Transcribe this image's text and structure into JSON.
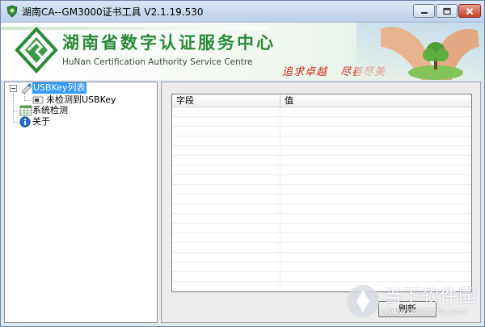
{
  "window": {
    "title": "湖南CA--GM3000证书工具  V2.1.19.530",
    "icons": {
      "app": "shield-icon",
      "minimize": "minimize-icon",
      "maximize": "maximize-icon",
      "close": "close-icon"
    }
  },
  "banner": {
    "org_name_cn": "湖南省数字认证服务中心",
    "org_name_en": "HuNan Certification Authority Service Centre",
    "slogan_1": "追求卓越",
    "slogan_2": "尽善尽美",
    "colors": {
      "org_green": "#2a8a38",
      "slogan_red": "#d12a1e"
    }
  },
  "tree": {
    "items": [
      {
        "label": "USBKey列表",
        "icon": "usbkey-icon",
        "selected": true,
        "expanded": true
      },
      {
        "label": "未检测到USBKey",
        "icon": "usb-device-icon"
      },
      {
        "label": "系统检测",
        "icon": "table-icon"
      },
      {
        "label": "关于",
        "icon": "info-icon"
      }
    ]
  },
  "details": {
    "columns": [
      "字段",
      "值"
    ],
    "rows": [],
    "refresh_label": "刷新"
  },
  "watermark": {
    "name": "当下软件园",
    "url": "www.downxia.com"
  },
  "colors": {
    "selection": "#3399ff",
    "window_frame": "#dfe8f3"
  }
}
